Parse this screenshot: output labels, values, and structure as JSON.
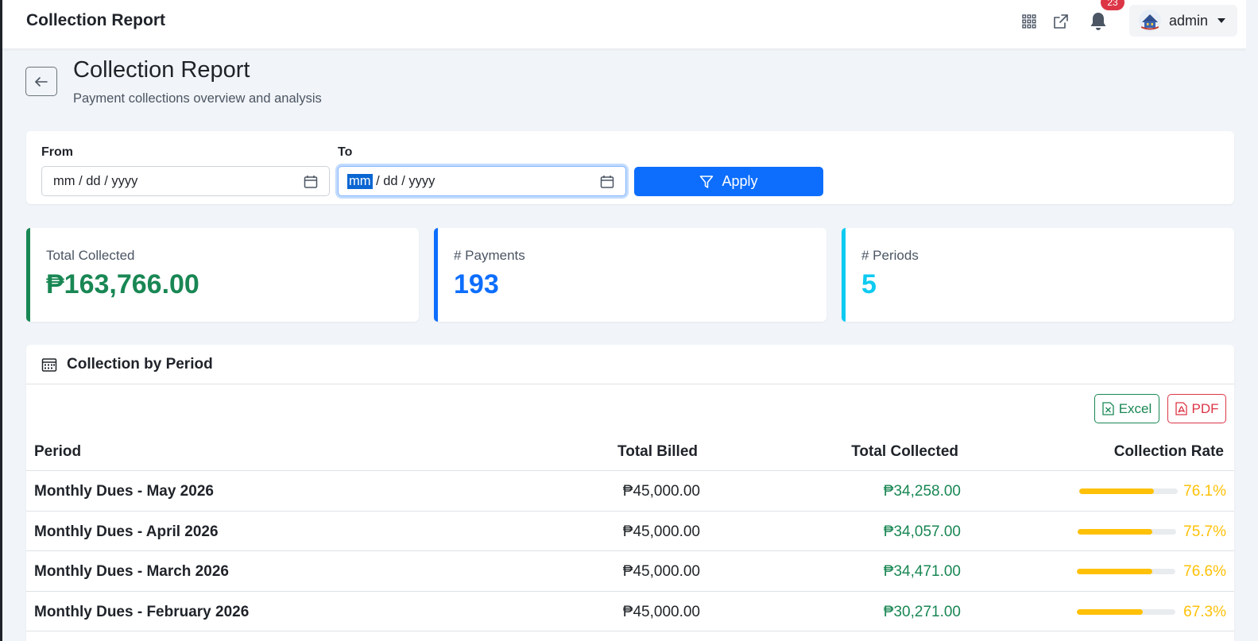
{
  "app": {
    "title": "Collection Report"
  },
  "topbar": {
    "icons": [
      "apps-grid-icon",
      "external-link-icon",
      "bell-icon"
    ],
    "notification_count": "23",
    "user": {
      "name": "admin",
      "avatar": "crest-avatar-icon"
    }
  },
  "header": {
    "back_icon": "arrow-left-icon",
    "title": "Collection Report",
    "subtitle": "Payment collections overview and analysis"
  },
  "filter": {
    "from_label": "From",
    "to_label": "To",
    "date_placeholder_mm": "mm",
    "date_placeholder_rest": " / dd / yyyy",
    "apply_label": "Apply"
  },
  "stats": [
    {
      "label": "Total Collected",
      "value": "₱163,766.00",
      "color": "#198754"
    },
    {
      "label": "# Payments",
      "value": "193",
      "color": "#0d6efd"
    },
    {
      "label": "# Periods",
      "value": "5",
      "color": "#0dcaf0"
    }
  ],
  "table": {
    "title": "Collection by Period",
    "excel_label": "Excel",
    "pdf_label": "PDF",
    "columns": [
      "Period",
      "Total Billed",
      "Total Collected",
      "Collection Rate"
    ],
    "rows": [
      {
        "period": "Monthly Dues - May 2026",
        "billed": "₱45,000.00",
        "collected": "₱34,258.00",
        "rate": "76.1%",
        "rate_value": 0.761
      },
      {
        "period": "Monthly Dues - April 2026",
        "billed": "₱45,000.00",
        "collected": "₱34,057.00",
        "rate": "75.7%",
        "rate_value": 0.757
      },
      {
        "period": "Monthly Dues - March 2026",
        "billed": "₱45,000.00",
        "collected": "₱34,471.00",
        "rate": "76.6%",
        "rate_value": 0.766
      },
      {
        "period": "Monthly Dues - February 2026",
        "billed": "₱45,000.00",
        "collected": "₱30,271.00",
        "rate": "67.3%",
        "rate_value": 0.673
      }
    ]
  },
  "colors": {
    "primary": "#0d6efd",
    "success": "#198754",
    "warning": "#ffc107",
    "info": "#0dcaf0",
    "danger": "#dc3545"
  }
}
